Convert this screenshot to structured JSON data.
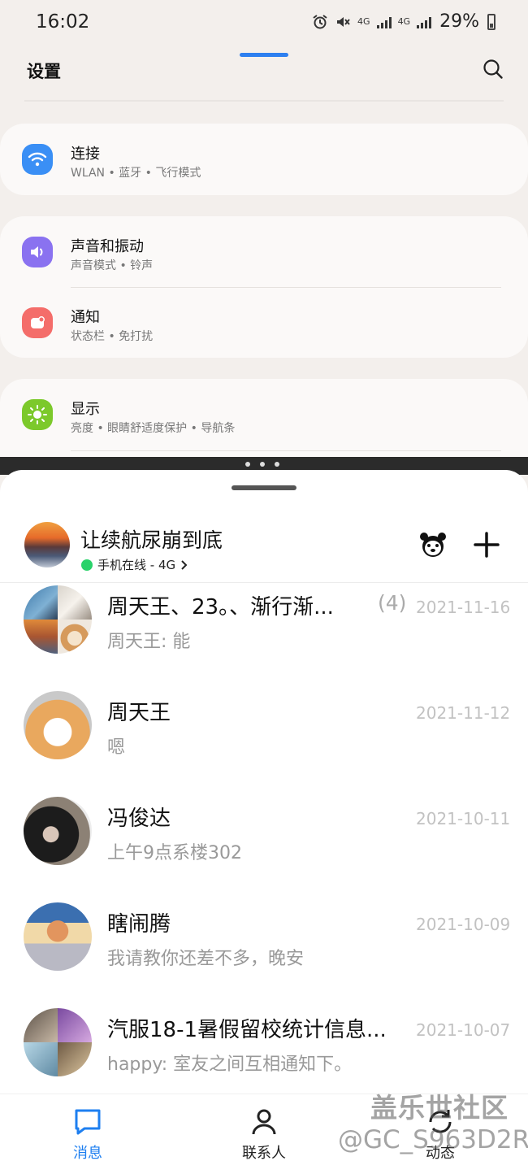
{
  "status_bar": {
    "time": "16:02",
    "network_1": "4G",
    "network_2": "4G",
    "battery": "29%"
  },
  "settings": {
    "title": "设置",
    "search_icon": "search-icon",
    "groups": [
      {
        "rows": [
          {
            "title": "连接",
            "subtitle": "WLAN • 蓝牙 • 飞行模式",
            "icon": "wifi-icon",
            "color": "#3a8ff5"
          }
        ]
      },
      {
        "rows": [
          {
            "title": "声音和振动",
            "subtitle": "声音模式 • 铃声",
            "icon": "volume-icon",
            "color": "#8a72f0"
          },
          {
            "title": "通知",
            "subtitle": "状态栏 • 免打扰",
            "icon": "notification-icon",
            "color": "#f46d6a"
          }
        ]
      },
      {
        "rows": [
          {
            "title": "显示",
            "subtitle": "亮度 • 眼睛舒适度保护 • 导航条",
            "icon": "brightness-icon",
            "color": "#7cc92b"
          }
        ]
      }
    ]
  },
  "chat_app": {
    "profile": {
      "name": "让续航尿崩到底",
      "status": "手机在线 - 4G",
      "status_color": "#2ad26a"
    },
    "conversations": [
      {
        "name": "周天王、23。、渐行渐...",
        "count": "(4)",
        "date": "2021-11-16",
        "message": "周天王: 能"
      },
      {
        "name": "周天王",
        "count": "",
        "date": "2021-11-12",
        "message": "嗯"
      },
      {
        "name": "冯俊达",
        "count": "",
        "date": "2021-10-11",
        "message": "上午9点系楼302"
      },
      {
        "name": "瞎闹腾",
        "count": "",
        "date": "2021-10-09",
        "message": "我请教你还差不多，晚安"
      },
      {
        "name": "汽服18-1暑假留校统计信息...",
        "count": "",
        "date": "2021-10-07",
        "message": "happy: 室友之间互相通知下。"
      }
    ],
    "nav": {
      "messages": "消息",
      "contacts": "联系人",
      "moments": "动态"
    },
    "accent_color": "#1e7ff0"
  },
  "watermark": {
    "line1": "盖乐世社区",
    "line2": "@GC_S963D2R"
  }
}
